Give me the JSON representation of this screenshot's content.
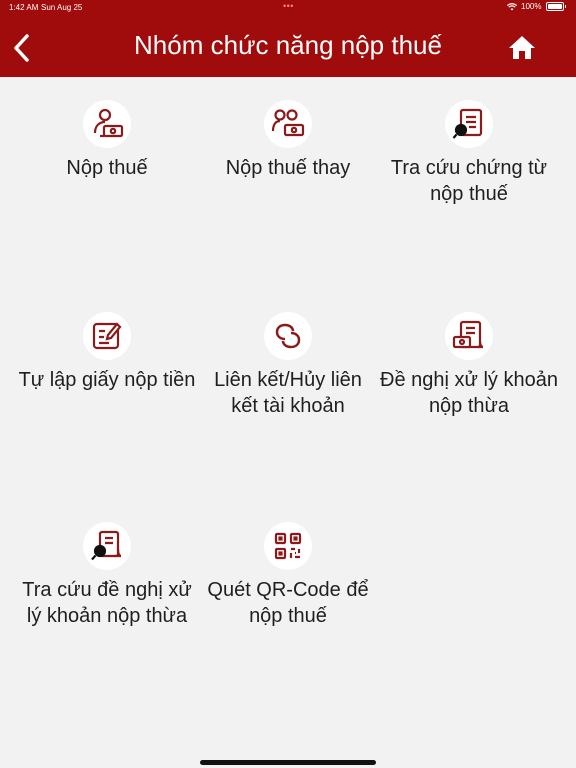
{
  "status_bar": {
    "time": "1:42 AM",
    "date": "Sun Aug 25",
    "battery": "100%"
  },
  "header": {
    "title": "Nhóm chức năng nộp thuế",
    "background_color": "#a00b0b"
  },
  "tiles": [
    {
      "label": "Nộp thuế",
      "icon": "person-money-icon"
    },
    {
      "label": "Nộp thuế thay",
      "icon": "people-money-icon"
    },
    {
      "label": "Tra cứu chứng từ nộp thuế",
      "icon": "document-search-icon"
    },
    {
      "label": "Tự lập giấy nộp tiền",
      "icon": "edit-form-icon"
    },
    {
      "label": "Liên kết/Hủy liên kết tài khoản",
      "icon": "link-icon"
    },
    {
      "label": "Đề nghị xử lý khoản nộp thừa",
      "icon": "document-money-icon"
    },
    {
      "label": "Tra cứu đề nghị xử lý khoản nộp thừa",
      "icon": "document-search-icon"
    },
    {
      "label": "Quét QR-Code để nộp thuế",
      "icon": "qr-code-icon"
    }
  ],
  "accent_color": "#a00b0b"
}
